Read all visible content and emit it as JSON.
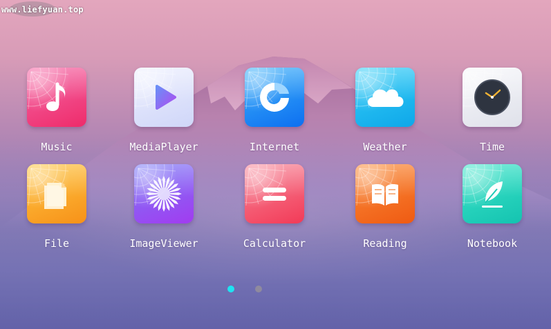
{
  "watermark": {
    "text": "www.liefyuan.top"
  },
  "apps": [
    {
      "label": "Music",
      "icon": "music-note-icon",
      "color_top": "#f569a8",
      "color_bottom": "#ee2b6a"
    },
    {
      "label": "MediaPlayer",
      "icon": "play-icon",
      "color_top": "#eef0ff",
      "color_bottom": "#cfd6f8"
    },
    {
      "label": "Internet",
      "icon": "internet-swirl-icon",
      "color_top": "#3fb4fb",
      "color_bottom": "#0d6ff0"
    },
    {
      "label": "Weather",
      "icon": "cloud-icon",
      "color_top": "#38d0f8",
      "color_bottom": "#0ea7e9"
    },
    {
      "label": "Time",
      "icon": "clock-icon",
      "color_top": "#f8f8fb",
      "color_bottom": "#dfe1ea"
    },
    {
      "label": "File",
      "icon": "file-icon",
      "color_top": "#ffc845",
      "color_bottom": "#f79118"
    },
    {
      "label": "ImageViewer",
      "icon": "flower-icon",
      "color_top": "#7a7df7",
      "color_bottom": "#a23bf0"
    },
    {
      "label": "Calculator",
      "icon": "equals-icon",
      "color_top": "#f88a9b",
      "color_bottom": "#f23a57"
    },
    {
      "label": "Reading",
      "icon": "open-book-icon",
      "color_top": "#fb8f3c",
      "color_bottom": "#ef5a12"
    },
    {
      "label": "Notebook",
      "icon": "feather-icon",
      "color_top": "#3fe6cb",
      "color_bottom": "#14c3b0"
    }
  ],
  "pager": {
    "active_index": 0,
    "count": 2,
    "active_color": "#1fe3f2",
    "inactive_color": "#8f8a9e"
  }
}
